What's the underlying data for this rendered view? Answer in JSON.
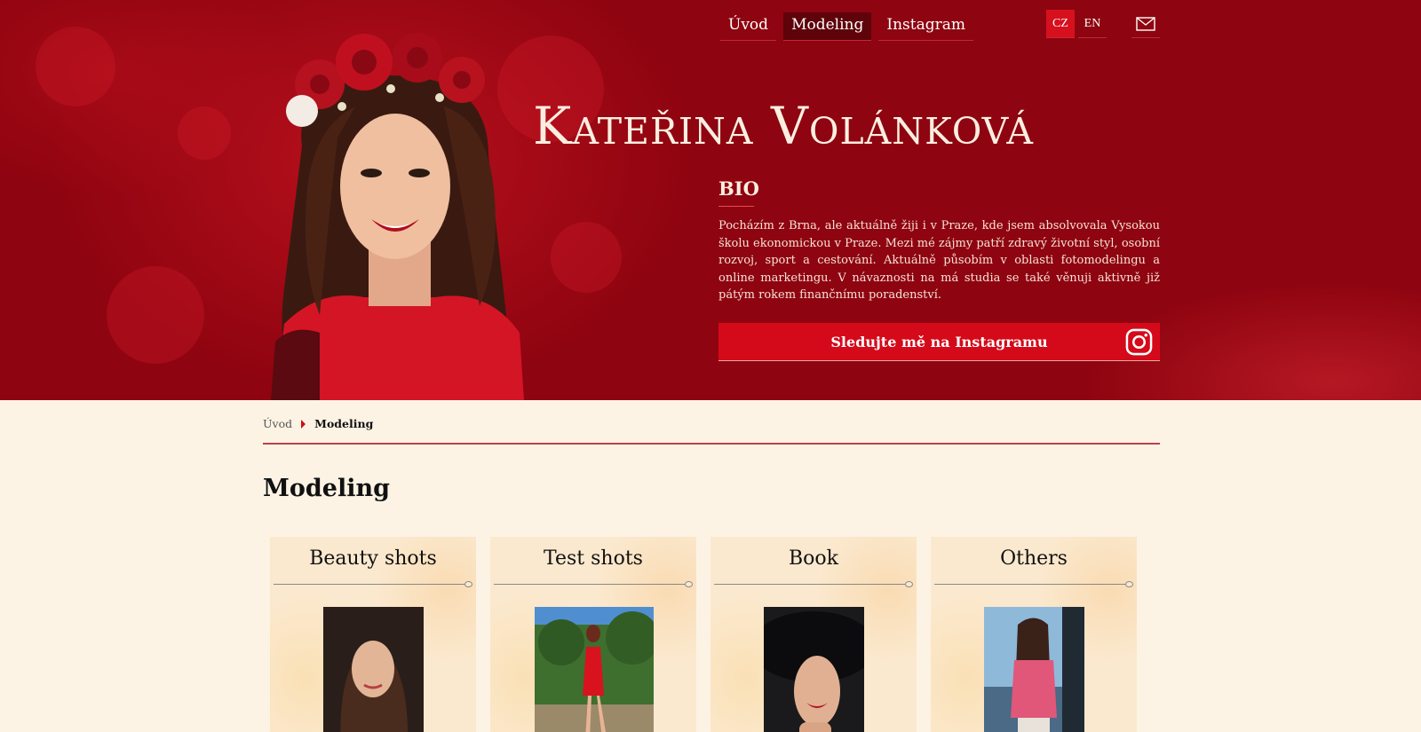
{
  "nav": {
    "items": [
      {
        "label": "Úvod",
        "active": false
      },
      {
        "label": "Modeling",
        "active": true
      },
      {
        "label": "Instagram",
        "active": false
      }
    ],
    "languages": [
      {
        "label": "CZ",
        "active": true
      },
      {
        "label": "EN",
        "active": false
      }
    ],
    "mail_icon": "mail-icon"
  },
  "hero": {
    "name": "Kateřina Volánková",
    "bio_title": "BIO",
    "bio_text": "Pocházím z Brna, ale aktuálně žiji i v Praze, kde jsem absolvovala Vysokou školu ekonomickou v Praze. Mezi mé zájmy patří zdravý životní styl, osobní rozvoj, sport a cestování. Aktuálně působím v oblasti fotomodelingu a online marketingu. V návaznosti na má studia se také věnuji aktivně již pátým rokem finančnímu poradenství.",
    "instagram_button": "Sledujte mě na Instagramu",
    "instagram_icon": "instagram-icon"
  },
  "breadcrumb": {
    "home": "Úvod",
    "current": "Modeling"
  },
  "page_title": "Modeling",
  "categories": [
    {
      "title": "Beauty shots"
    },
    {
      "title": "Test shots"
    },
    {
      "title": "Book"
    },
    {
      "title": "Others"
    }
  ],
  "colors": {
    "hero_red": "#8e0410",
    "accent_red": "#d40a1a",
    "cream": "#fdf3e4"
  }
}
